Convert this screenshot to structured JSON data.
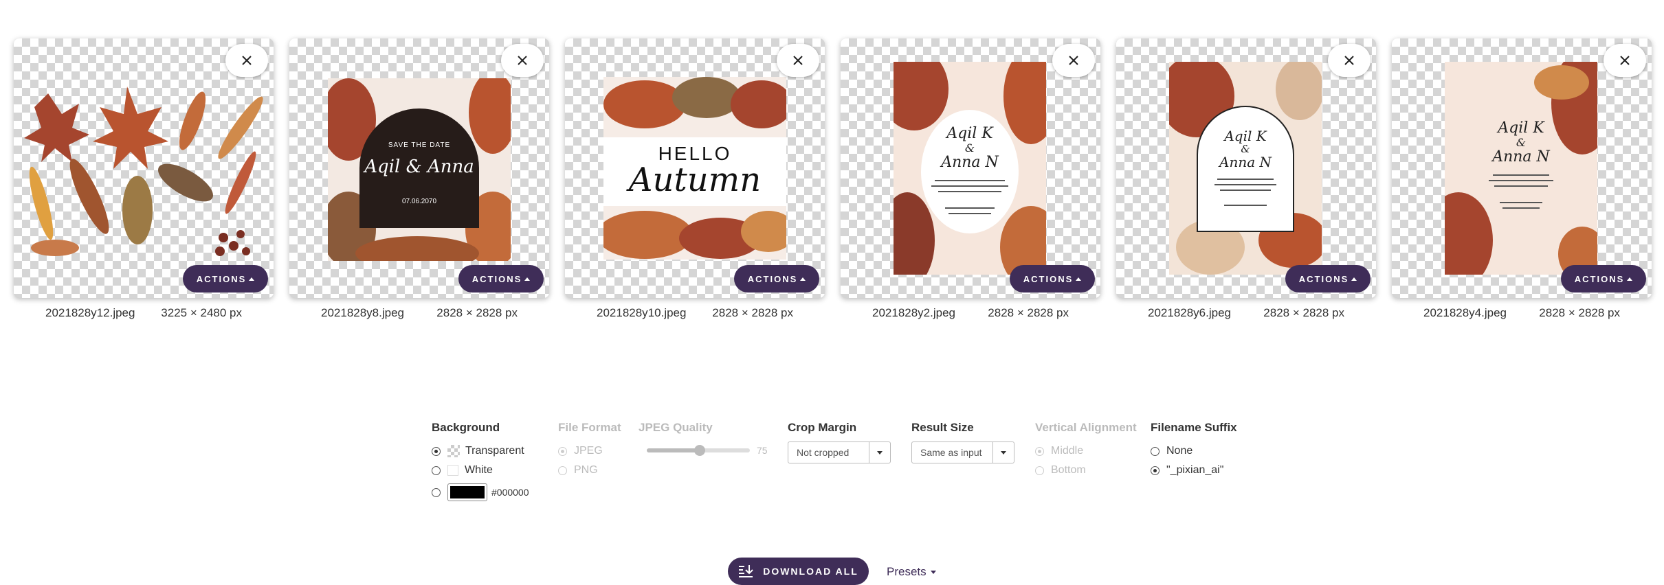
{
  "images": [
    {
      "filename": "2021828y12.jpeg",
      "dimensions": "3225 × 2480 px",
      "actions_label": "ACTIONS"
    },
    {
      "filename": "2021828y8.jpeg",
      "dimensions": "2828 × 2828 px",
      "actions_label": "ACTIONS",
      "art": {
        "top": "SAVE THE DATE",
        "names": "Aqil & Anna",
        "date": "07.06.2070"
      }
    },
    {
      "filename": "2021828y10.jpeg",
      "dimensions": "2828 × 2828 px",
      "actions_label": "ACTIONS",
      "art": {
        "hello": "HELLO",
        "autumn": "Autumn"
      }
    },
    {
      "filename": "2021828y2.jpeg",
      "dimensions": "2828 × 2828 px",
      "actions_label": "ACTIONS",
      "art": {
        "name1": "Aqil K",
        "amp": "&",
        "name2": "Anna N"
      }
    },
    {
      "filename": "2021828y6.jpeg",
      "dimensions": "2828 × 2828 px",
      "actions_label": "ACTIONS",
      "art": {
        "name1": "Aqil K",
        "amp": "&",
        "name2": "Anna N"
      }
    },
    {
      "filename": "2021828y4.jpeg",
      "dimensions": "2828 × 2828 px",
      "actions_label": "ACTIONS",
      "art": {
        "name1": "Aqil K",
        "amp": "&",
        "name2": "Anna N"
      }
    }
  ],
  "controls": {
    "background": {
      "title": "Background",
      "options": [
        "Transparent",
        "White"
      ],
      "selected": "Transparent",
      "color_value": "#000000"
    },
    "file_format": {
      "title": "File Format",
      "options": [
        "JPEG",
        "PNG"
      ],
      "selected": "JPEG",
      "enabled": false
    },
    "jpeg_quality": {
      "title": "JPEG Quality",
      "value": "75",
      "enabled": false
    },
    "crop_margin": {
      "title": "Crop Margin",
      "value": "Not cropped"
    },
    "result_size": {
      "title": "Result Size",
      "value": "Same as input"
    },
    "vertical_alignment": {
      "title": "Vertical Alignment",
      "options": [
        "Middle",
        "Bottom"
      ],
      "selected": "Middle",
      "enabled": false
    },
    "filename_suffix": {
      "title": "Filename Suffix",
      "options": [
        "None",
        "\"_pixian_ai\""
      ],
      "selected": "\"_pixian_ai\""
    }
  },
  "footer": {
    "download_label": "DOWNLOAD ALL",
    "presets_label": "Presets"
  },
  "colors": {
    "accent": "#3f2d58",
    "checker": "#d5d5d5"
  }
}
